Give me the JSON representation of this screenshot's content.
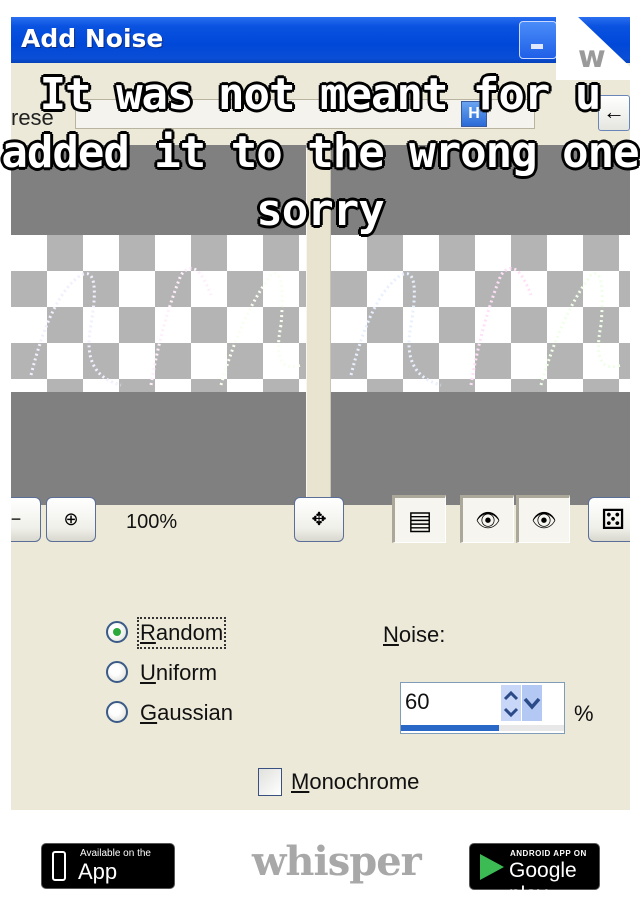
{
  "dialog": {
    "title": "Add Noise",
    "preset_label": "rese",
    "preset_help_glyph": "H",
    "preset_back_glyph": "←",
    "minimize_icon": "minimize-icon"
  },
  "toolbar": {
    "zoom_out_glyph": "−",
    "zoom_in_glyph": "⊕",
    "zoom_level": "100%",
    "pan_glyph": "✥",
    "proof_glyph": "▤",
    "lock_preview_glyph": "👁",
    "preview_glyph": "👁",
    "randomize_glyph": "⚄"
  },
  "options": {
    "noise_types": [
      {
        "label": "Random",
        "underline": "R",
        "rest": "andom",
        "checked": true
      },
      {
        "label": "Uniform",
        "underline": "U",
        "rest": "niform",
        "checked": false
      },
      {
        "label": "Gaussian",
        "underline": "G",
        "rest": "aussian",
        "checked": false
      }
    ],
    "noise_label_underline": "N",
    "noise_label_rest": "oise:",
    "noise_value": "60",
    "noise_percent": 60,
    "percent_symbol": "%",
    "monochrome_underline": "M",
    "monochrome_rest": "onochrome",
    "monochrome_checked": false
  },
  "caption": {
    "lines": [
      "It was not meant for u",
      "added it to the wrong one",
      "sorry"
    ]
  },
  "whisper": {
    "corner_letter": "w",
    "logo": "whisper",
    "appstore_small": "Available on the",
    "appstore_big": "App Store",
    "googleplay_small": "ANDROID APP ON",
    "googleplay_big": "Google play"
  },
  "colors": {
    "titlebar": "#0048d8",
    "dialog_bg": "#ece9d8",
    "slider_fill": "#2a68c8",
    "radio_dot": "#2aa83a"
  }
}
